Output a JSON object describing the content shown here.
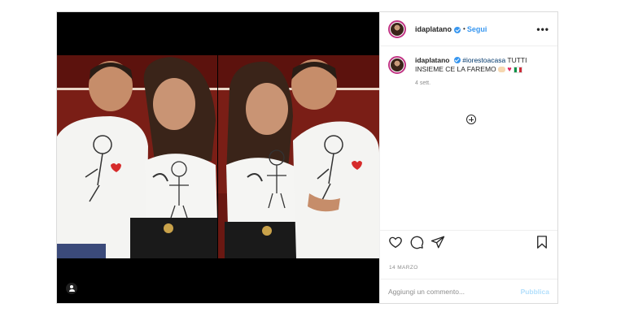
{
  "post": {
    "username": "idaplatano",
    "follow_label": "Segui",
    "separator": "•",
    "more_label": "•••",
    "caption": {
      "username": "idaplatano",
      "hashtag": "#iorestoacasa",
      "text": "TUTTI INSIEME CE LA FAREMO",
      "time_ago": "4 sett."
    },
    "date": "14 MARZO",
    "comment_placeholder": "Aggiungi un commento...",
    "publish_label": "Pubblica"
  },
  "colors": {
    "link": "#3897f0",
    "story_ring": "#c13584",
    "background": "#ffffff"
  },
  "icons": {
    "like": "heart-icon",
    "comment": "comment-icon",
    "share": "paper-plane-icon",
    "save": "bookmark-icon",
    "tag": "user-tag-icon",
    "load_more": "plus-circle-icon"
  }
}
